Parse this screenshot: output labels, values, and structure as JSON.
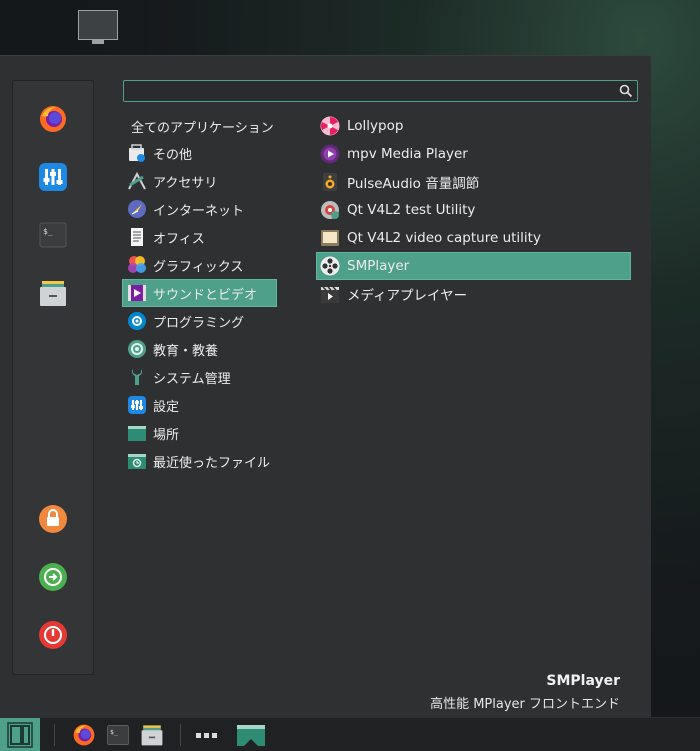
{
  "search": {
    "placeholder": "",
    "value": ""
  },
  "categories": [
    {
      "label": "全てのアプリケーション",
      "icon": "none"
    },
    {
      "label": "その他",
      "icon": "other-icon"
    },
    {
      "label": "アクセサリ",
      "icon": "accessories-icon"
    },
    {
      "label": "インターネット",
      "icon": "internet-icon"
    },
    {
      "label": "オフィス",
      "icon": "office-icon"
    },
    {
      "label": "グラフィックス",
      "icon": "graphics-icon"
    },
    {
      "label": "サウンドとビデオ",
      "icon": "sound-video-icon",
      "selected": true
    },
    {
      "label": "プログラミング",
      "icon": "programming-icon"
    },
    {
      "label": "教育・教養",
      "icon": "education-icon"
    },
    {
      "label": "システム管理",
      "icon": "system-icon"
    },
    {
      "label": "設定",
      "icon": "settings-icon"
    },
    {
      "label": "場所",
      "icon": "places-icon"
    },
    {
      "label": "最近使ったファイル",
      "icon": "recent-files-icon"
    }
  ],
  "apps": [
    {
      "label": "Lollypop",
      "icon": "lollypop-icon"
    },
    {
      "label": "mpv Media Player",
      "icon": "mpv-icon"
    },
    {
      "label": "PulseAudio 音量調節",
      "icon": "pulseaudio-icon"
    },
    {
      "label": "Qt V4L2 test Utility",
      "icon": "qv4l2-icon"
    },
    {
      "label": "Qt V4L2 video capture utility",
      "icon": "qvidcap-icon"
    },
    {
      "label": "SMPlayer",
      "icon": "smplayer-icon",
      "selected": true
    },
    {
      "label": "メディアプレイヤー",
      "icon": "media-player-icon"
    }
  ],
  "description": {
    "name": "SMPlayer",
    "text": "高性能 MPlayer フロントエンド"
  },
  "colors": {
    "accent": "#4fa08b",
    "menu_bg": "#2f3031",
    "panel_bg": "#1f2123"
  }
}
